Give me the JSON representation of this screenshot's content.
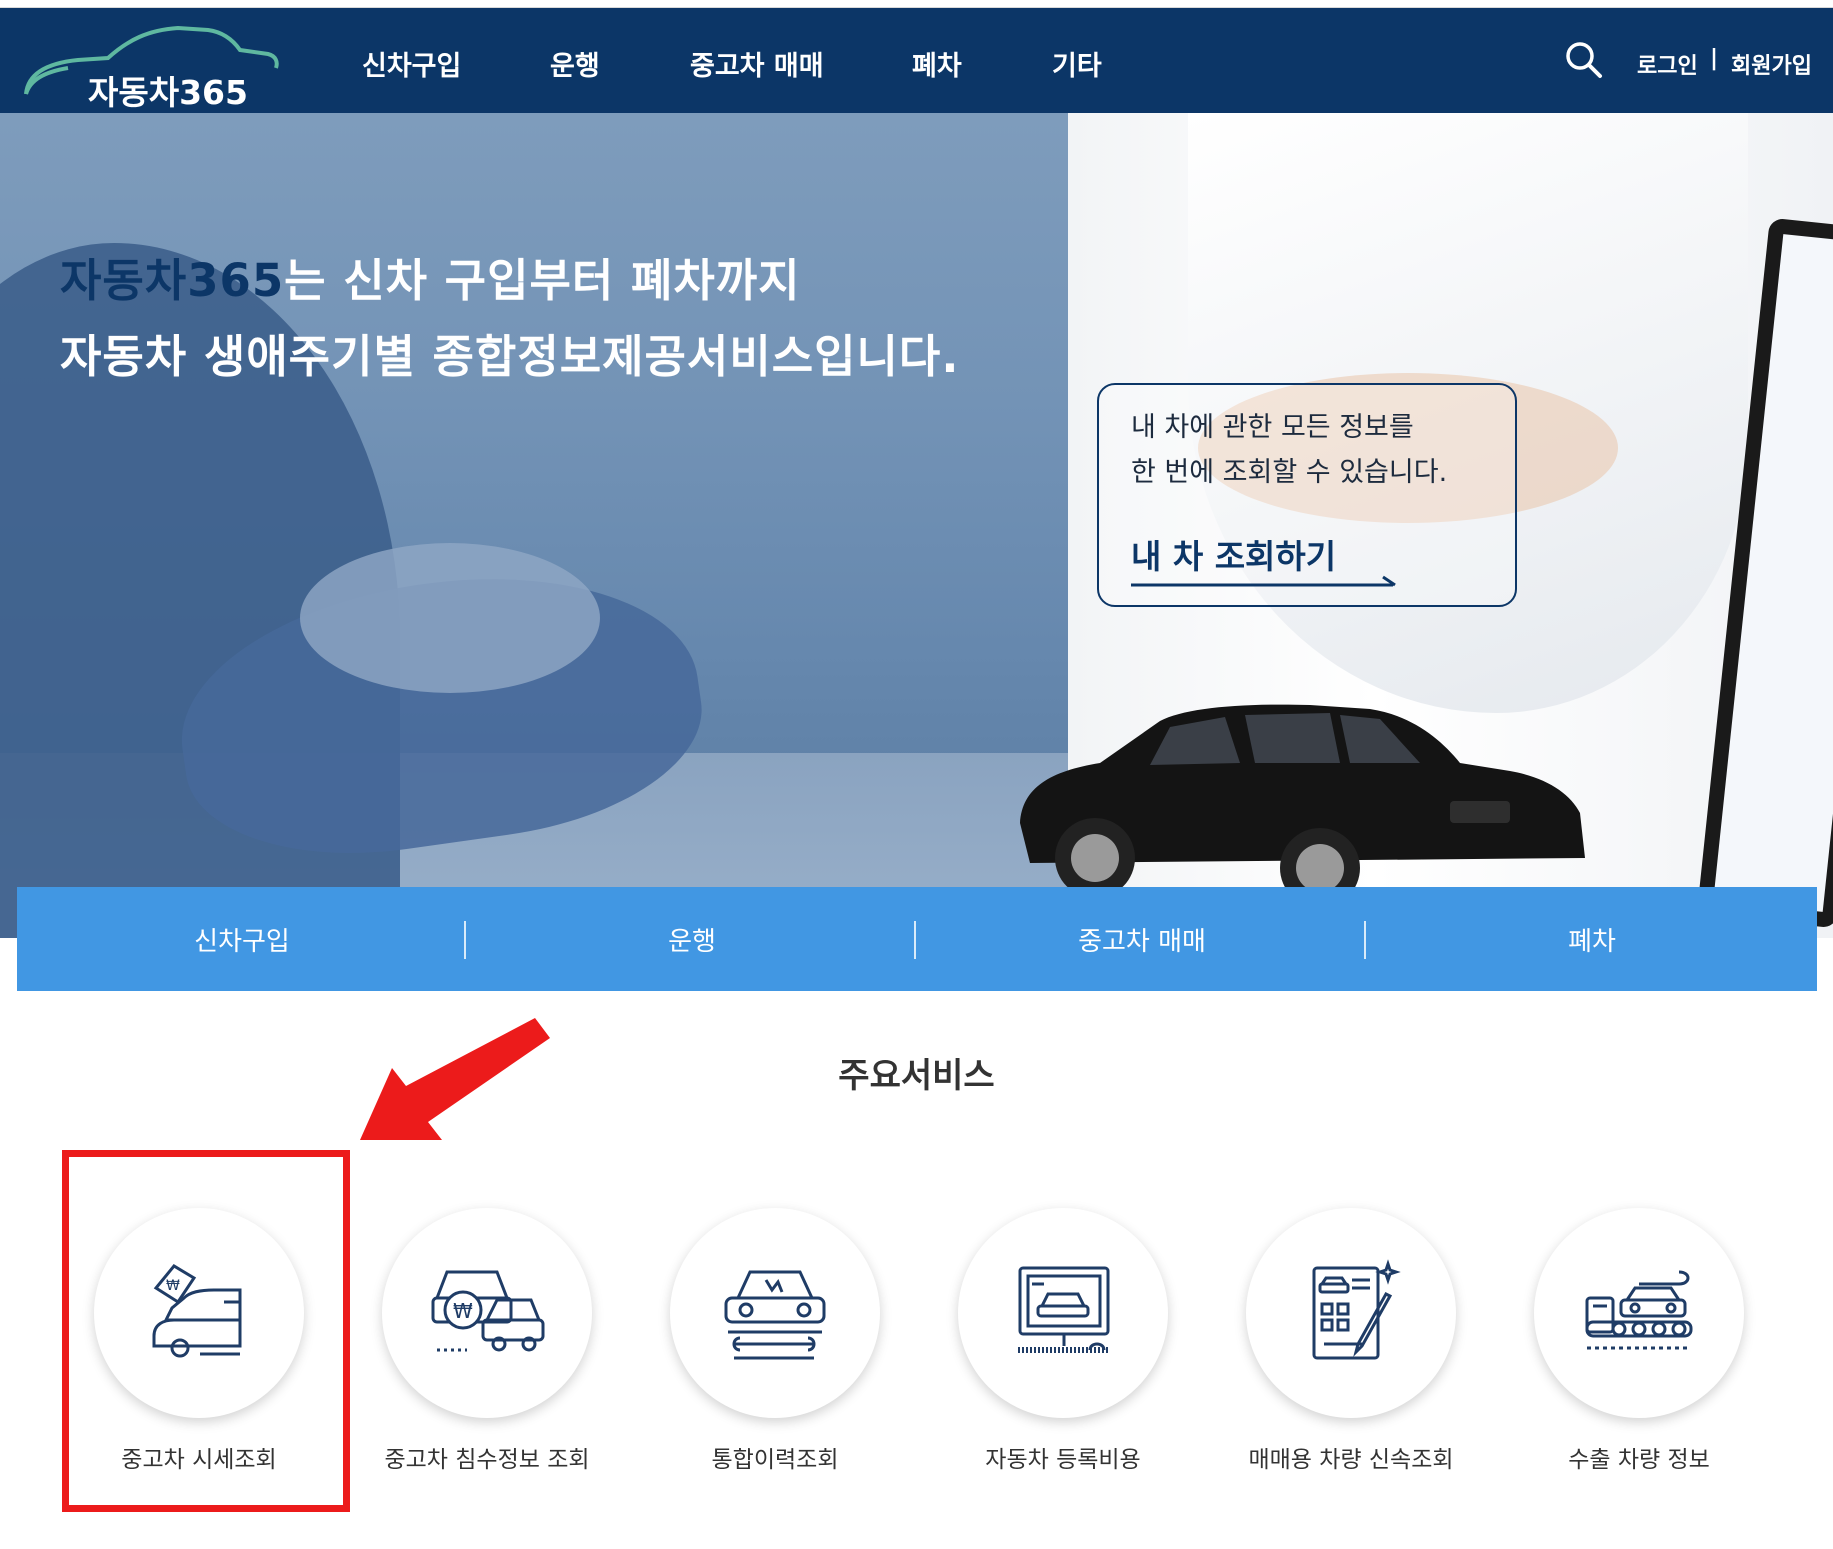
{
  "header": {
    "logo_text": "자동차365",
    "nav": [
      "신차구입",
      "운행",
      "중고차 매매",
      "폐차",
      "기타"
    ],
    "search_icon": "search-icon",
    "login_label": "로그인",
    "separator": "|",
    "join_label": "회원가입"
  },
  "hero": {
    "title_brand": "자동차365",
    "title_line1_rest": "는 신차 구입부터 폐차까지",
    "title_line2": "자동차 생애주기별 종합정보제공서비스입니다.",
    "callout_line1": "내 차에 관한 모든 정보를",
    "callout_line2": "한 번에 조회할 수 있습니다.",
    "callout_link": "내 차 조회하기"
  },
  "subnav": [
    "신차구입",
    "운행",
    "중고차 매매",
    "폐차"
  ],
  "services": {
    "title": "주요서비스",
    "items": [
      {
        "label": "중고차 시세조회",
        "icon": "used-car-price-icon"
      },
      {
        "label": "중고차 침수정보 조회",
        "icon": "flood-car-icon"
      },
      {
        "label": "통합이력조회",
        "icon": "car-repair-history-icon"
      },
      {
        "label": "자동차 등록비용",
        "icon": "registration-cost-icon"
      },
      {
        "label": "매매용 차량 신속조회",
        "icon": "document-pen-icon"
      },
      {
        "label": "수출 차량 정보",
        "icon": "export-truck-icon"
      }
    ]
  },
  "colors": {
    "header_bg": "#0c3667",
    "subnav_bg": "#4197e3",
    "highlight": "#ec1b1b",
    "icon": "#1f3c66"
  }
}
